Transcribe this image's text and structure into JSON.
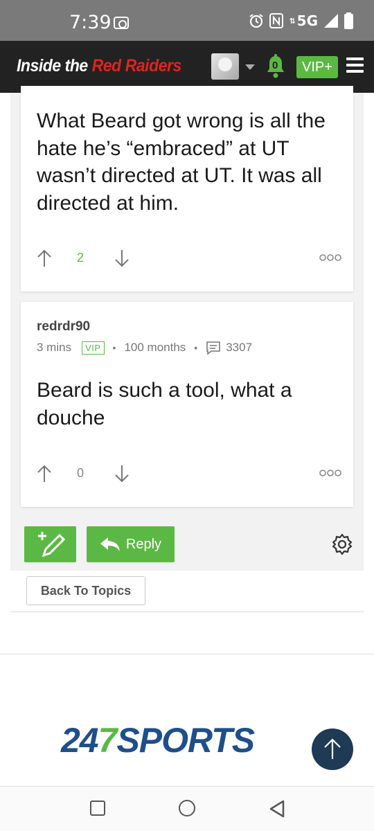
{
  "status": {
    "time": "7:39",
    "network": "5G"
  },
  "nav": {
    "logo_white": "Inside the ",
    "logo_red": "Red Raiders",
    "bell_count": "0",
    "vip_label": "VIP+"
  },
  "posts": [
    {
      "body": "What Beard got wrong is all the hate he’s “embraced” at UT wasn’t directed at UT. It was all directed at him.",
      "votes": "2"
    },
    {
      "username": "redrdr90",
      "time": "3 mins",
      "badge": "VIP",
      "tenure": "100 months",
      "post_count": "3307",
      "body": "Beard is such a tool, what a douche",
      "votes": "0"
    }
  ],
  "actions": {
    "reply_label": "Reply",
    "back_label": "Back To Topics"
  },
  "footer": {
    "brand_num_a": "24",
    "brand_num_b": "7",
    "brand_word": "SPORTS"
  },
  "colors": {
    "green": "#5cb845",
    "red": "#e2231a",
    "dark": "#222222",
    "brand_blue": "#1f4f8a"
  }
}
